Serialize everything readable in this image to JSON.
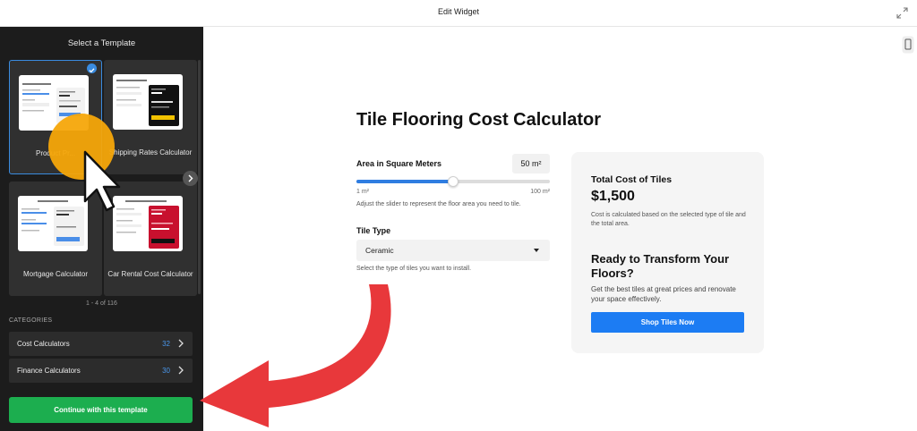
{
  "header": {
    "title": "Edit Widget",
    "expand_icon": "expand-icon"
  },
  "sidebar": {
    "title": "Select a Template",
    "templates": [
      {
        "label": "Product Pr...",
        "thumb_title": "The Flooring Cost Calculator",
        "selected": true
      },
      {
        "label": "Shipping Rates Calculator",
        "thumb_title": "Shipping Rates Calculator",
        "selected": false
      },
      {
        "label": "Mortgage Calculator",
        "thumb_title": "Mortgage Calculator",
        "selected": false
      },
      {
        "label": "Car Rental Cost Calculator",
        "thumb_title": "Car Rental Cost Calculator",
        "selected": false
      }
    ],
    "pagination": "1 - 4 of 116",
    "categories_heading": "CATEGORIES",
    "categories": [
      {
        "label": "Cost Calculators",
        "count": "32"
      },
      {
        "label": "Finance Calculators",
        "count": "30"
      }
    ],
    "continue_label": "Continue with this template"
  },
  "preview": {
    "title": "Tile Flooring Cost Calculator",
    "area": {
      "label": "Area in Square Meters",
      "value": "50 m²",
      "min_label": "1 m²",
      "max_label": "100 m²",
      "slider_fraction": 0.5,
      "help": "Adjust the slider to represent the floor area you need to tile."
    },
    "tile": {
      "label": "Tile Type",
      "selected": "Ceramic",
      "help": "Select the type of tiles you want to install."
    },
    "result": {
      "heading": "Total Cost of Tiles",
      "amount": "$1,500",
      "note": "Cost is calculated based on the selected type of tile and the total area.",
      "cta_heading": "Ready to Transform Your Floors?",
      "cta_text": "Get the best tiles at great prices and renovate your space effectively.",
      "button": "Shop Tiles Now"
    }
  },
  "colors": {
    "accent_blue": "#1c7cf3",
    "continue_green": "#1cae4f",
    "cursor_highlight": "#f5a60a",
    "annotation_arrow": "#e8383b"
  }
}
